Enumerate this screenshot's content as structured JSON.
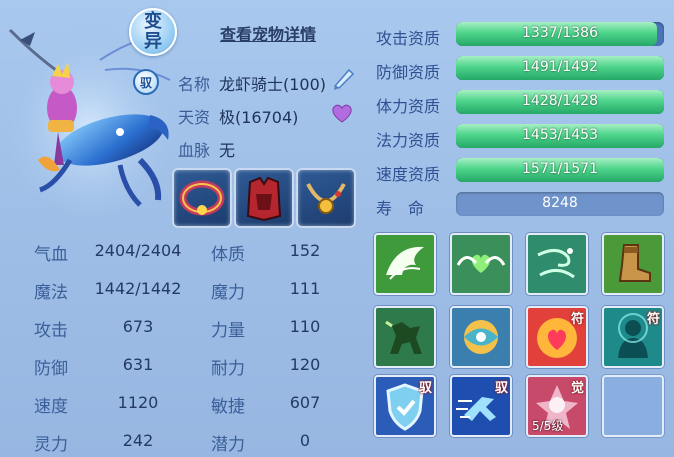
{
  "pet": {
    "variant_badge": "变异",
    "ride_badge": "驭",
    "view_detail": "查看宠物详情",
    "name_label": "名称",
    "name_value": "龙虾骑士(100)",
    "aptitude_label": "天资",
    "aptitude_value": "极(16704)",
    "bloodline_label": "血脉",
    "bloodline_value": "无"
  },
  "equipment": [
    {
      "icon": "bracelet-icon"
    },
    {
      "icon": "armor-icon"
    },
    {
      "icon": "necklace-icon"
    }
  ],
  "qualities": [
    {
      "label": "攻击资质",
      "value": "1337/1386",
      "fraction": 0.965
    },
    {
      "label": "防御资质",
      "value": "1491/1492",
      "fraction": 0.999
    },
    {
      "label": "体力资质",
      "value": "1428/1428",
      "fraction": 1.0
    },
    {
      "label": "法力资质",
      "value": "1453/1453",
      "fraction": 1.0
    },
    {
      "label": "速度资质",
      "value": "1571/1571",
      "fraction": 1.0
    }
  ],
  "life": {
    "label": "寿　命",
    "value": "8248"
  },
  "stats_left": [
    {
      "label": "气血",
      "value": "2404/2404"
    },
    {
      "label": "魔法",
      "value": "1442/1442"
    },
    {
      "label": "攻击",
      "value": "673"
    },
    {
      "label": "防御",
      "value": "631"
    },
    {
      "label": "速度",
      "value": "1120"
    },
    {
      "label": "灵力",
      "value": "242"
    }
  ],
  "stats_right": [
    {
      "label": "体质",
      "value": "152"
    },
    {
      "label": "魔力",
      "value": "111"
    },
    {
      "label": "力量",
      "value": "110"
    },
    {
      "label": "耐力",
      "value": "120"
    },
    {
      "label": "敏捷",
      "value": "607"
    },
    {
      "label": "潜力",
      "value": "0"
    }
  ],
  "skills": [
    {
      "icon": "wing-icon",
      "tag": ""
    },
    {
      "icon": "heart-wings-icon",
      "tag": ""
    },
    {
      "icon": "wind-icon",
      "tag": ""
    },
    {
      "icon": "boot-icon",
      "tag": ""
    },
    {
      "icon": "horse-icon",
      "tag": ""
    },
    {
      "icon": "orb-icon",
      "tag": ""
    },
    {
      "icon": "heart-fire-icon",
      "tag": "符"
    },
    {
      "icon": "spirit-icon",
      "tag": "符"
    },
    {
      "icon": "shield-icon",
      "tag": "驭"
    },
    {
      "icon": "dash-icon",
      "tag": "驭"
    },
    {
      "icon": "awaken-icon",
      "tag": "觉",
      "level": "5/5级"
    },
    {
      "icon": "",
      "tag": ""
    }
  ],
  "colors": {
    "bar_fill": "#4ed48b",
    "bar_track": "#4b74b6",
    "background": "#9fc0e8"
  }
}
